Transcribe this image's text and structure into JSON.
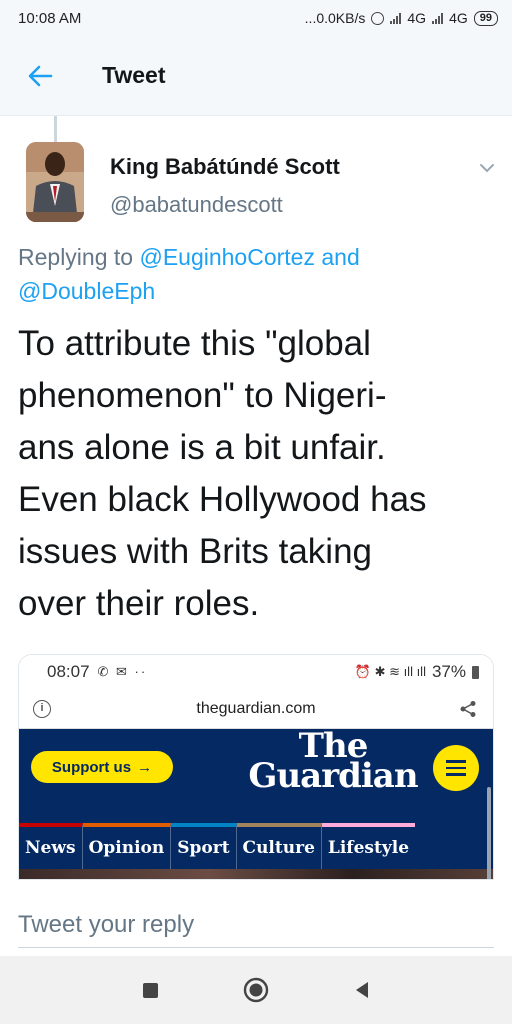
{
  "status_bar": {
    "time": "10:08 AM",
    "speed": "...0.0KB/s",
    "network1": "4G",
    "network2": "4G",
    "battery": "99"
  },
  "app_bar": {
    "title": "Tweet",
    "back_icon": "arrow-left-icon"
  },
  "tweet": {
    "author_name": "King Babátúndé Scott",
    "author_handle": "@babatundescott",
    "replying_prefix": "Replying to ",
    "reply_to_1": "@EuginhoCortez",
    "replying_and": " and",
    "reply_to_2": "@DoubleEph",
    "text_lines": [
      "To attribute this \"global",
      "phenomenon\" to Nigeri-",
      "ans alone is a bit unfair.",
      "Even black Hollywood has",
      "issues with Brits taking",
      "over their roles."
    ]
  },
  "media": {
    "phone_time": "08:07",
    "phone_battery": "37%",
    "url": "theguardian.com",
    "support_label": "Support us",
    "logo_line1": "The",
    "logo_line2": "Guardian",
    "nav": [
      {
        "label": "News",
        "color": "#c70000"
      },
      {
        "label": "Opinion",
        "color": "#e05e00"
      },
      {
        "label": "Sport",
        "color": "#0084c6"
      },
      {
        "label": "Culture",
        "color": "#a1845c"
      },
      {
        "label": "Lifestyle",
        "color": "#ffabdb"
      }
    ]
  },
  "reply": {
    "placeholder": "Tweet your reply"
  },
  "colors": {
    "accent": "#1da1f2",
    "guardian_blue": "#052962",
    "guardian_yellow": "#ffe500"
  }
}
